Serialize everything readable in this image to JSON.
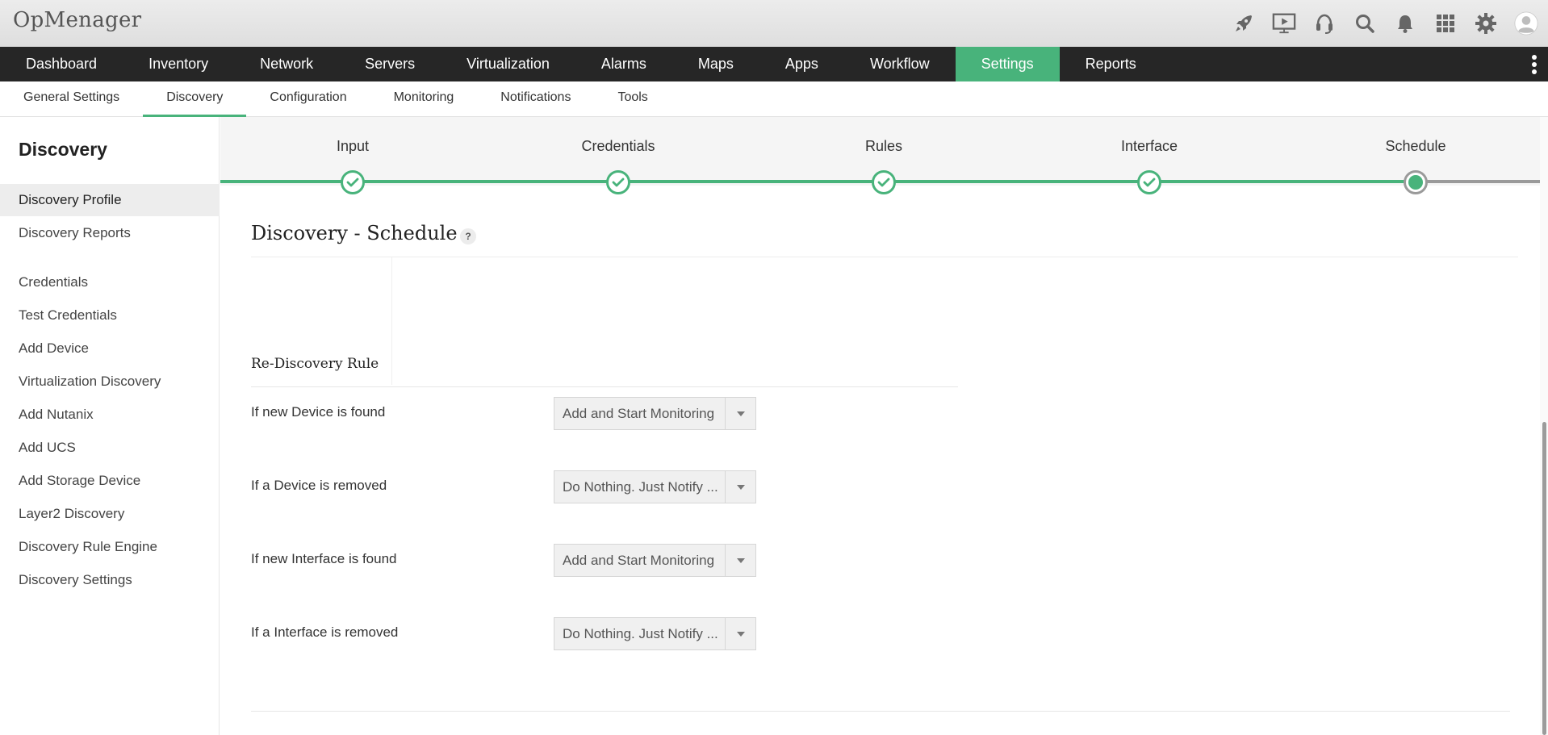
{
  "app": {
    "name": "OpMenager"
  },
  "top_icons": [
    "rocket-icon",
    "presentation-icon",
    "headset-icon",
    "search-icon",
    "bell-icon",
    "apps-grid-icon",
    "gear-icon",
    "user-avatar-icon"
  ],
  "main_nav": {
    "items": [
      {
        "label": "Dashboard"
      },
      {
        "label": "Inventory"
      },
      {
        "label": "Network"
      },
      {
        "label": "Servers"
      },
      {
        "label": "Virtualization"
      },
      {
        "label": "Alarms"
      },
      {
        "label": "Maps"
      },
      {
        "label": "Apps"
      },
      {
        "label": "Workflow"
      },
      {
        "label": "Settings"
      },
      {
        "label": "Reports"
      }
    ],
    "active": "Settings"
  },
  "sub_nav": {
    "items": [
      {
        "label": "General Settings"
      },
      {
        "label": "Discovery"
      },
      {
        "label": "Configuration"
      },
      {
        "label": "Monitoring"
      },
      {
        "label": "Notifications"
      },
      {
        "label": "Tools"
      }
    ],
    "active": "Discovery"
  },
  "sidebar": {
    "title": "Discovery",
    "items": [
      {
        "label": "Discovery Profile"
      },
      {
        "label": "Discovery Reports"
      },
      {
        "label": "Credentials"
      },
      {
        "label": "Test Credentials"
      },
      {
        "label": "Add Device"
      },
      {
        "label": "Virtualization Discovery"
      },
      {
        "label": "Add Nutanix"
      },
      {
        "label": "Add UCS"
      },
      {
        "label": "Add Storage Device"
      },
      {
        "label": "Layer2 Discovery"
      },
      {
        "label": "Discovery Rule Engine"
      },
      {
        "label": "Discovery Settings"
      }
    ],
    "active": "Discovery Profile"
  },
  "wizard": {
    "steps": [
      {
        "label": "Input",
        "status": "complete"
      },
      {
        "label": "Credentials",
        "status": "complete"
      },
      {
        "label": "Rules",
        "status": "complete"
      },
      {
        "label": "Interface",
        "status": "complete"
      },
      {
        "label": "Schedule",
        "status": "current"
      }
    ]
  },
  "page": {
    "title": "Discovery - Schedule",
    "help_icon": "?"
  },
  "rediscovery": {
    "title": "Re-Discovery Rule",
    "rules": [
      {
        "label": "If new Device is found",
        "value": "Add and Start Monitoring"
      },
      {
        "label": "If a Device is removed",
        "value": "Do Nothing. Just Notify ..."
      },
      {
        "label": "If new Interface is found",
        "value": "Add and Start Monitoring"
      },
      {
        "label": "If a Interface is removed",
        "value": "Do Nothing. Just Notify ..."
      }
    ]
  },
  "colors": {
    "accent": "#48b37b",
    "nav_bg": "#262626",
    "header_bg": "#e4e4e4"
  }
}
